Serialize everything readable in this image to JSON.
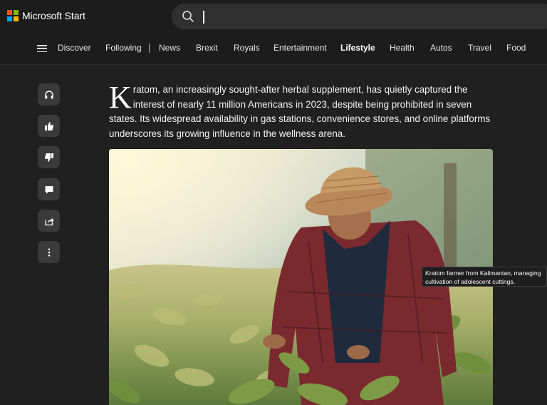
{
  "brand": {
    "name": "Microsoft Start",
    "logo_colors": [
      "#f25022",
      "#7fba00",
      "#00a4ef",
      "#ffb900"
    ]
  },
  "search": {
    "value": "",
    "placeholder": ""
  },
  "nav": {
    "items": [
      {
        "label": "Discover",
        "active": false
      },
      {
        "label": "Following",
        "active": false
      },
      {
        "label": "News",
        "active": false
      },
      {
        "label": "Brexit",
        "active": false
      },
      {
        "label": "Royals",
        "active": false
      },
      {
        "label": "Entertainment",
        "active": false
      },
      {
        "label": "Lifestyle",
        "active": true
      },
      {
        "label": "Health",
        "active": false
      },
      {
        "label": "Autos",
        "active": false
      },
      {
        "label": "Travel",
        "active": false
      },
      {
        "label": "Food",
        "active": false
      }
    ]
  },
  "rail": {
    "actions": [
      "headphones-icon",
      "thumbs-up-icon",
      "thumbs-down-icon",
      "comment-icon",
      "share-icon",
      "more-icon"
    ]
  },
  "article": {
    "dropcap": "K",
    "lead": "ratom, an increasingly sought-after herbal supplement, has quietly captured the interest of nearly 11 million Americans in 2023, despite being prohibited in seven states. Its widespread availability in gas stations, convenience stores, and online platforms underscores its growing influence in the wellness arena."
  },
  "image": {
    "tooltip_line1": "Kratom farmer from Kalimantan, managing",
    "tooltip_line2": "cultivation of adolescent cuttings."
  },
  "colors": {
    "background": "#202020",
    "header": "#1c1c1c",
    "rail_button": "#3a3a3a",
    "search_bg": "#303030"
  }
}
